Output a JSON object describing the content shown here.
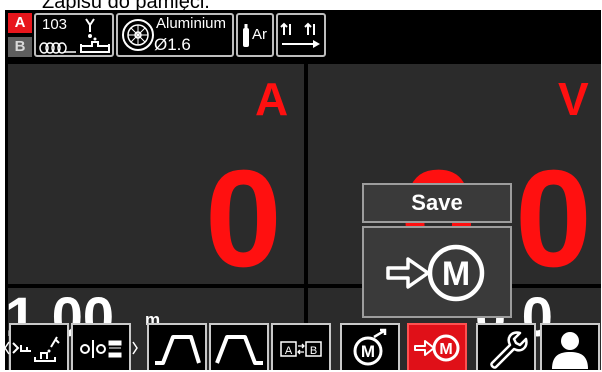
{
  "caption": "Zapisu do pamięci.",
  "memory": {
    "a_label": "A",
    "b_label": "B"
  },
  "process": {
    "number": "103"
  },
  "wire": {
    "material": "Aluminium",
    "diameter": "Ø1.6"
  },
  "gas": {
    "label": "Ar"
  },
  "readouts": {
    "current_unit": "A",
    "current_value": "0",
    "voltage_unit": "V",
    "voltage_value": "0.0",
    "wfs_value": "1.00",
    "wfs_unit": "m",
    "right_lower_value": "0.0"
  },
  "save_dialog": {
    "title": "Save",
    "icon_letter": "M"
  },
  "toolbar": {
    "items": [
      "welding-process",
      "gun-trigger-mode",
      "arc-start-procedure",
      "arc-end-procedure",
      "a-b-procedure",
      "memory-recall",
      "memory-save",
      "settings",
      "user"
    ],
    "active": "memory-save"
  },
  "colors": {
    "accent_red": "#ff1010",
    "panel": "#2b2b2b",
    "background": "#000000"
  }
}
